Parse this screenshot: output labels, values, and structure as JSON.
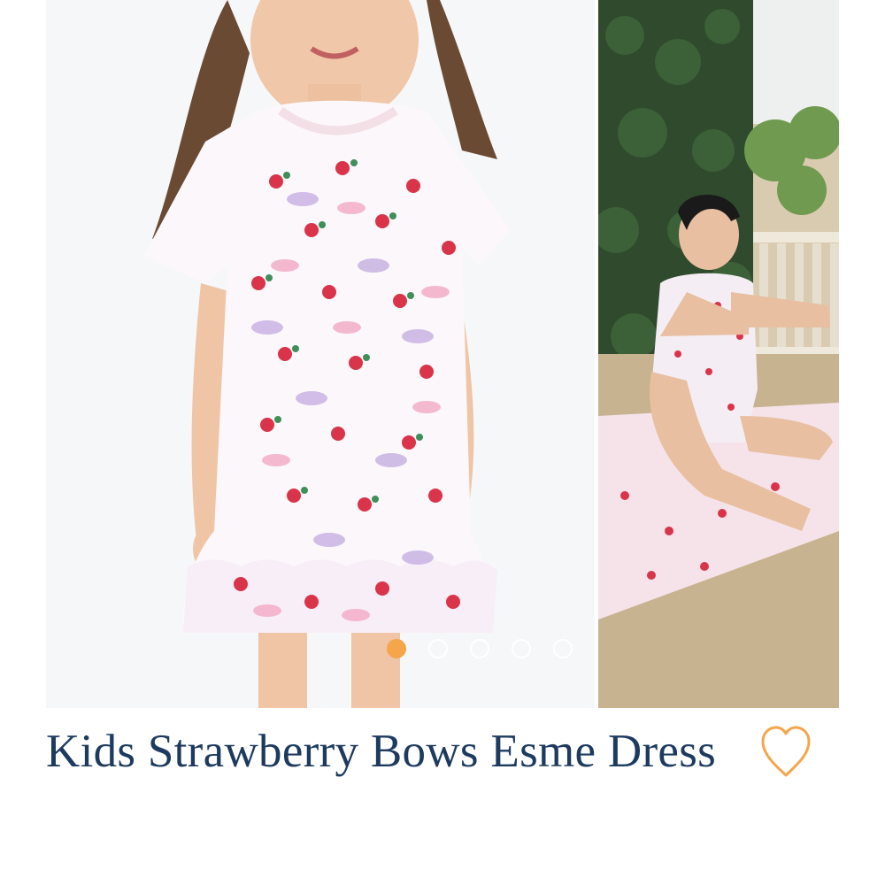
{
  "product": {
    "title": "Kids Strawberry Bows Esme Dress"
  },
  "carousel": {
    "slide_count": 5,
    "active_index": 0,
    "images": [
      {
        "name": "child-in-dress-photo"
      },
      {
        "name": "woman-in-pajamas-photo"
      }
    ]
  },
  "icons": {
    "wishlist": "heart-outline-icon"
  },
  "colors": {
    "title": "#1d3a5f",
    "accent": "#f5a54a",
    "dot_inactive": "#ffffff"
  }
}
